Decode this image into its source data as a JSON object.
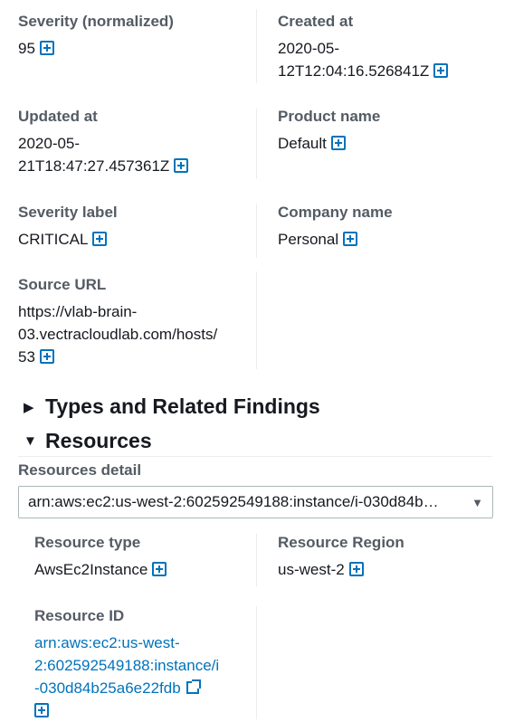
{
  "summary": {
    "severity_normalized": {
      "label": "Severity (normalized)",
      "value": "95"
    },
    "created_at": {
      "label": "Created at",
      "line1": "2020-05-",
      "line2": "12T12:04:16.526841Z"
    },
    "updated_at": {
      "label": "Updated at",
      "line1": "2020-05-",
      "line2": "21T18:47:27.457361Z"
    },
    "product_name": {
      "label": "Product name",
      "value": "Default"
    },
    "severity_label": {
      "label": "Severity label",
      "value": "CRITICAL"
    },
    "company_name": {
      "label": "Company name",
      "value": "Personal"
    },
    "source_url": {
      "label": "Source URL",
      "line1": "https://vlab-brain-",
      "line2": "03.vectracloudlab.com/hosts/",
      "line3": "53"
    }
  },
  "sections": {
    "types": {
      "title": "Types and Related Findings",
      "expanded": false
    },
    "resources": {
      "title": "Resources",
      "expanded": true
    }
  },
  "resources": {
    "detail_label": "Resources detail",
    "selected": "arn:aws:ec2:us-west-2:602592549188:instance/i-030d84b…",
    "resource_type": {
      "label": "Resource type",
      "value": "AwsEc2Instance"
    },
    "resource_region": {
      "label": "Resource Region",
      "value": "us-west-2"
    },
    "resource_id": {
      "label": "Resource ID",
      "line1": "arn:aws:ec2:us-west-",
      "line2": "2:602592549188:instance/i",
      "line3": "-030d84b25a6e22fdb"
    }
  },
  "icons": {
    "filter": "plus-box-icon",
    "external": "external-link-icon",
    "caret": "caret-down-icon",
    "collapsed": "triangle-right-icon",
    "expanded": "triangle-down-icon"
  },
  "colors": {
    "link": "#0073bb",
    "label": "#545b64",
    "text": "#16191f",
    "divider": "#eaeded"
  }
}
